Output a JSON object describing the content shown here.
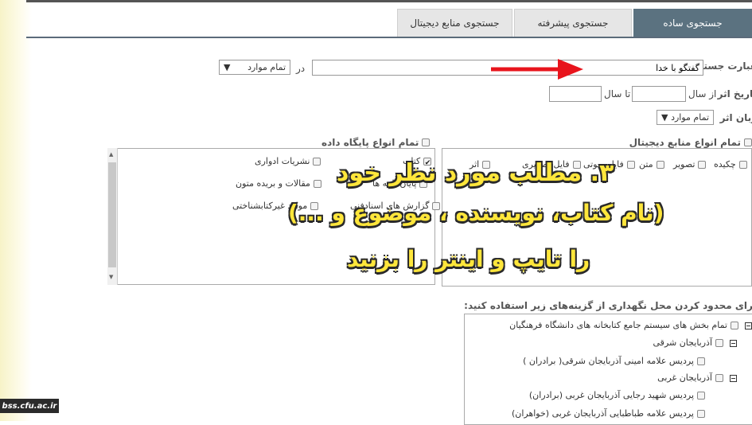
{
  "tabs": [
    {
      "label": "جستجوی ساده",
      "active": true
    },
    {
      "label": "جستجوی پیشرفته",
      "active": false
    },
    {
      "label": "جستجوی منابع دیجیتال",
      "active": false
    }
  ],
  "search": {
    "label": "عبارت جستجو",
    "value": "گفتگو با خدا",
    "in_label": "در",
    "scope": "تمام موارد"
  },
  "date": {
    "label": "تاریخ اثر",
    "from_label": "از سال",
    "to_label": "تا سال"
  },
  "language": {
    "label": "زبان اثر",
    "value": "تمام موارد"
  },
  "digital_types": {
    "header": "تمام انواع منابع دیجیتال",
    "items": [
      "چکیده",
      "تصویر",
      "متن",
      "فایل صوتی",
      "فایل تصویری",
      "اثر"
    ]
  },
  "db_types": {
    "header": "تمام انواع پایگاه داده",
    "items": [
      "نشریات ادواری",
      "کتاب",
      "مقالات و بریده متون",
      "پایان نامه ها",
      "موارد غیرکتابشناختی",
      "گزارش های اسنادفنی"
    ]
  },
  "location": {
    "prompt": "برای محدود کردن محل نگهداری از گزینه‌های زیر استفاده کنید:",
    "tree": [
      {
        "label": "تمام بخش های سیستم جامع کتابخانه های دانشگاه فرهنگیان",
        "level": 0
      },
      {
        "label": "آذربایجان شرقی",
        "level": 1
      },
      {
        "label": "پردیس علامه امینی آذربایجان شرقی( برادران )",
        "level": 2
      },
      {
        "label": "آذربایجان غربی",
        "level": 1
      },
      {
        "label": "پردیس شهید رجایی آذربایجان غربی (برادران)",
        "level": 2
      },
      {
        "label": "پردیس علامه طباطبایی آذربایجان غربی (خواهران)",
        "level": 2
      }
    ]
  },
  "overlay": {
    "line1": "۳. مطلب مورد نظر خود",
    "line2": "(نام کتاب، نویسنده ، موضوع و ...)",
    "line3": "را تایپ و اینتر را بزنید",
    "color": "#ffe63b"
  },
  "arrow_color": "#e8141c",
  "watermark": "bss.cfu.ac.ir",
  "dropdown_glyph": "▼"
}
